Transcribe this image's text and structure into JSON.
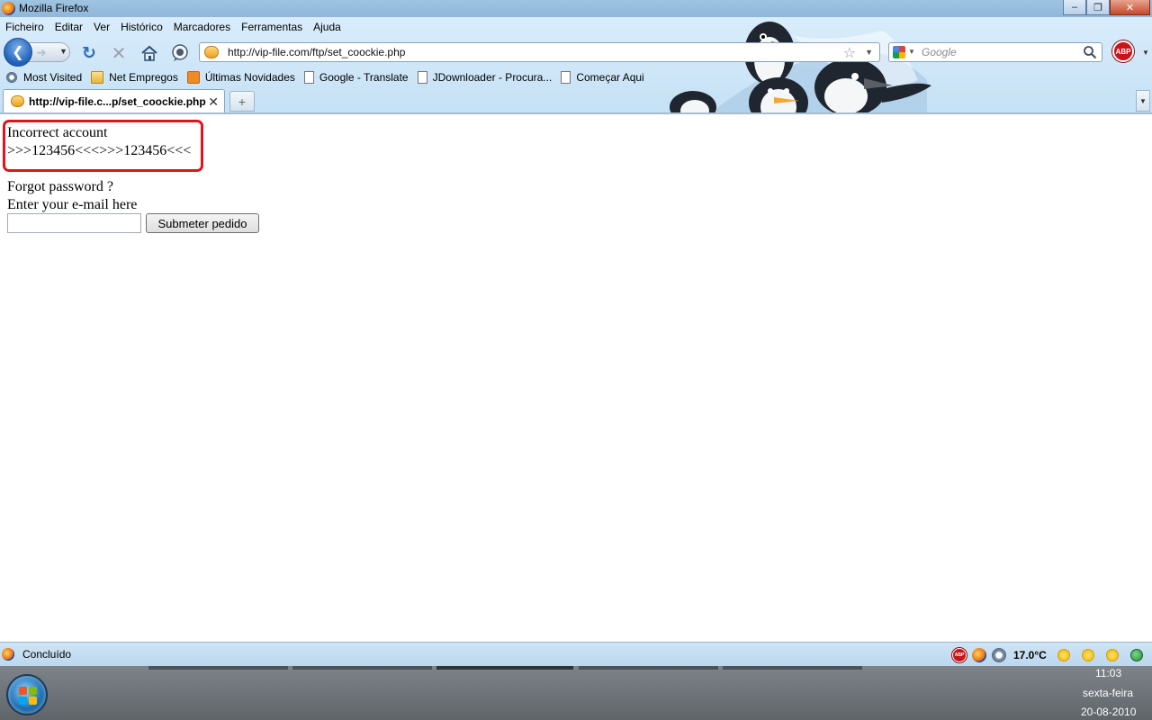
{
  "window": {
    "title": "Mozilla Firefox"
  },
  "menu": [
    "Ficheiro",
    "Editar",
    "Ver",
    "Histórico",
    "Marcadores",
    "Ferramentas",
    "Ajuda"
  ],
  "navigation": {
    "url": "http://vip-file.com/ftp/set_coockie.php",
    "search_placeholder": "Google",
    "adblock_label": "ABP"
  },
  "bookmarks": [
    {
      "label": "Most Visited",
      "icon": "gear-icon"
    },
    {
      "label": "Net Empregos",
      "icon": "folder-icon"
    },
    {
      "label": "Últimas Novidades",
      "icon": "rss-icon"
    },
    {
      "label": "Google - Translate",
      "icon": "page-icon"
    },
    {
      "label": "JDownloader - Procura...",
      "icon": "page-icon"
    },
    {
      "label": "Começar Aqui",
      "icon": "page-icon"
    }
  ],
  "tab": {
    "title": "http://vip-file.c...p/set_coockie.php"
  },
  "page": {
    "message_line1": "Incorrect account",
    "message_line2": ">>>123456<<<>>>123456<<<",
    "forgot": "Forgot password ?",
    "enter_email": "Enter your e-mail here",
    "email_value": "",
    "submit_label": "Submeter pedido"
  },
  "status": {
    "text": "Concluído",
    "temperature": "17.0°C"
  },
  "taskbar": {
    "time": "11:03",
    "day": "sexta-feira",
    "date": "20-08-2010"
  },
  "colors": {
    "highlight": "#e0141d",
    "chrome": "#c5e1f5"
  }
}
